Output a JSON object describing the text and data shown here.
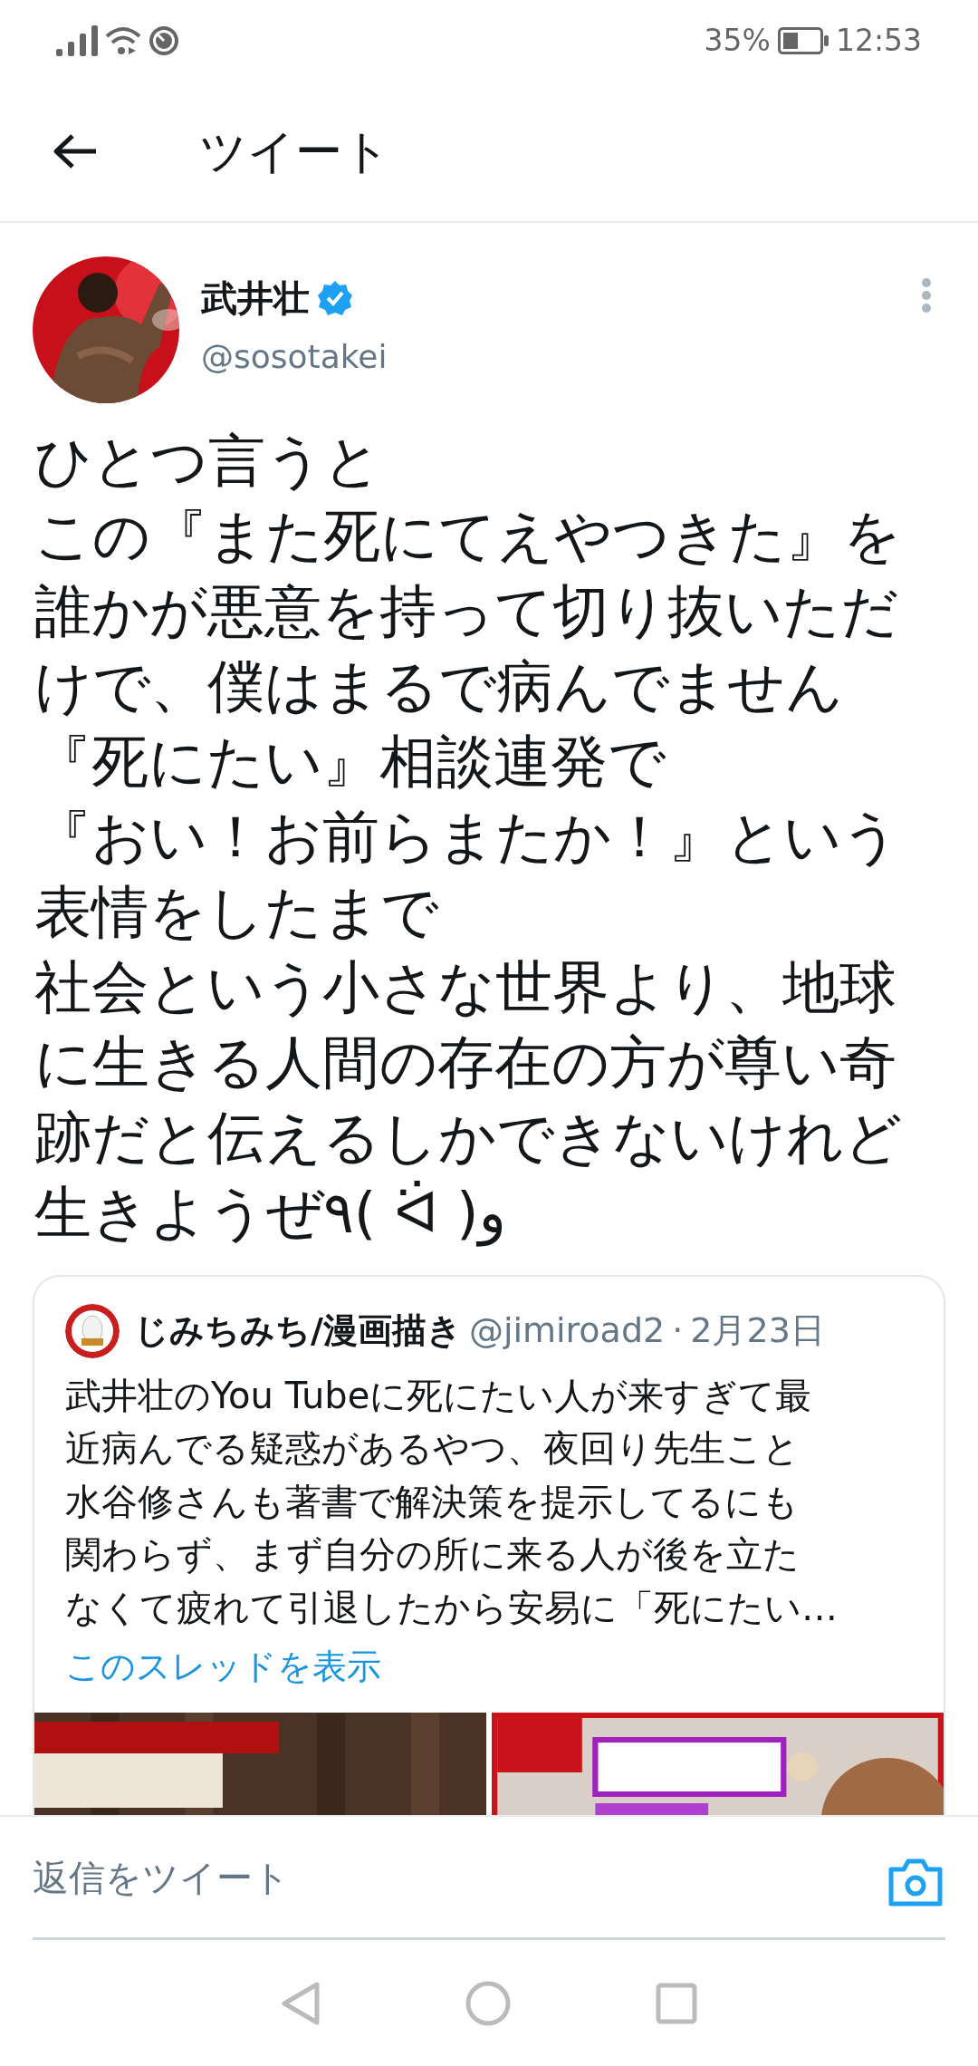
{
  "status_bar": {
    "battery": "35%",
    "time": "12:53"
  },
  "header": {
    "title": "ツイート"
  },
  "tweet": {
    "author": {
      "name": "武井壮",
      "handle": "@sosotakei",
      "verified": true
    },
    "lines": [
      "ひとつ言うと",
      "この『また死にてえやつきた』を",
      "誰かが悪意を持って切り抜いただ",
      "けで、僕はまるで病んでません",
      "『死にたい』相談連発で",
      "『おい！お前らまたか！』という",
      "表情をしたまで",
      "社会という小さな世界より、地球",
      "に生きる人間の存在の方が尊い奇",
      "跡だと伝えるしかできないけれど",
      "生きようぜ٩( ᐛ )و"
    ],
    "quoted": {
      "name": "じみちみち/漫画描き",
      "handle": "@jimiroad2",
      "separator": "·",
      "date": "2月23日",
      "text_lines": [
        "武井壮のYou Tubeに死にたい人が来すぎて最",
        "近病んでる疑惑があるやつ、夜回り先生こと",
        "水谷修さんも著書で解決策を提示してるにも",
        "関わらず、まず自分の所に来る人が後を立た",
        "なくて疲れて引退したから安易に「死にたい…"
      ],
      "link": "このスレッドを表示"
    }
  },
  "reply_bar": {
    "placeholder": "返信をツイート"
  }
}
